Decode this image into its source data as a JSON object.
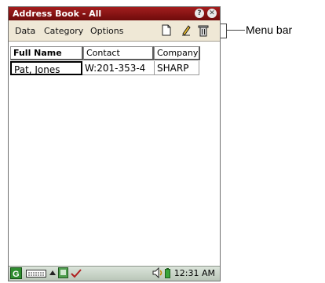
{
  "window": {
    "title": "Address Book - All"
  },
  "menubar": {
    "items": [
      {
        "label": "Data"
      },
      {
        "label": "Category"
      },
      {
        "label": "Options"
      }
    ],
    "tools": [
      "new-page-icon",
      "edit-pencil-icon",
      "trash-icon"
    ]
  },
  "table": {
    "columns": [
      "Full Name",
      "Contact",
      "Company"
    ],
    "rows": [
      {
        "full_name": "Pat, Jones",
        "contact": "W:201-353-4",
        "company": "SHARP"
      }
    ]
  },
  "taskbar": {
    "time": "12:31 AM",
    "icons": [
      "start-icon",
      "keyboard-icon",
      "up-arrow-icon",
      "app-icon",
      "check-icon",
      "speaker-icon",
      "battery-icon"
    ]
  },
  "annotation": {
    "label": "Menu bar"
  },
  "colors": {
    "titlebar": "#8b1414",
    "menubar": "#efe8d6",
    "taskbar": "#c8d2c6"
  }
}
